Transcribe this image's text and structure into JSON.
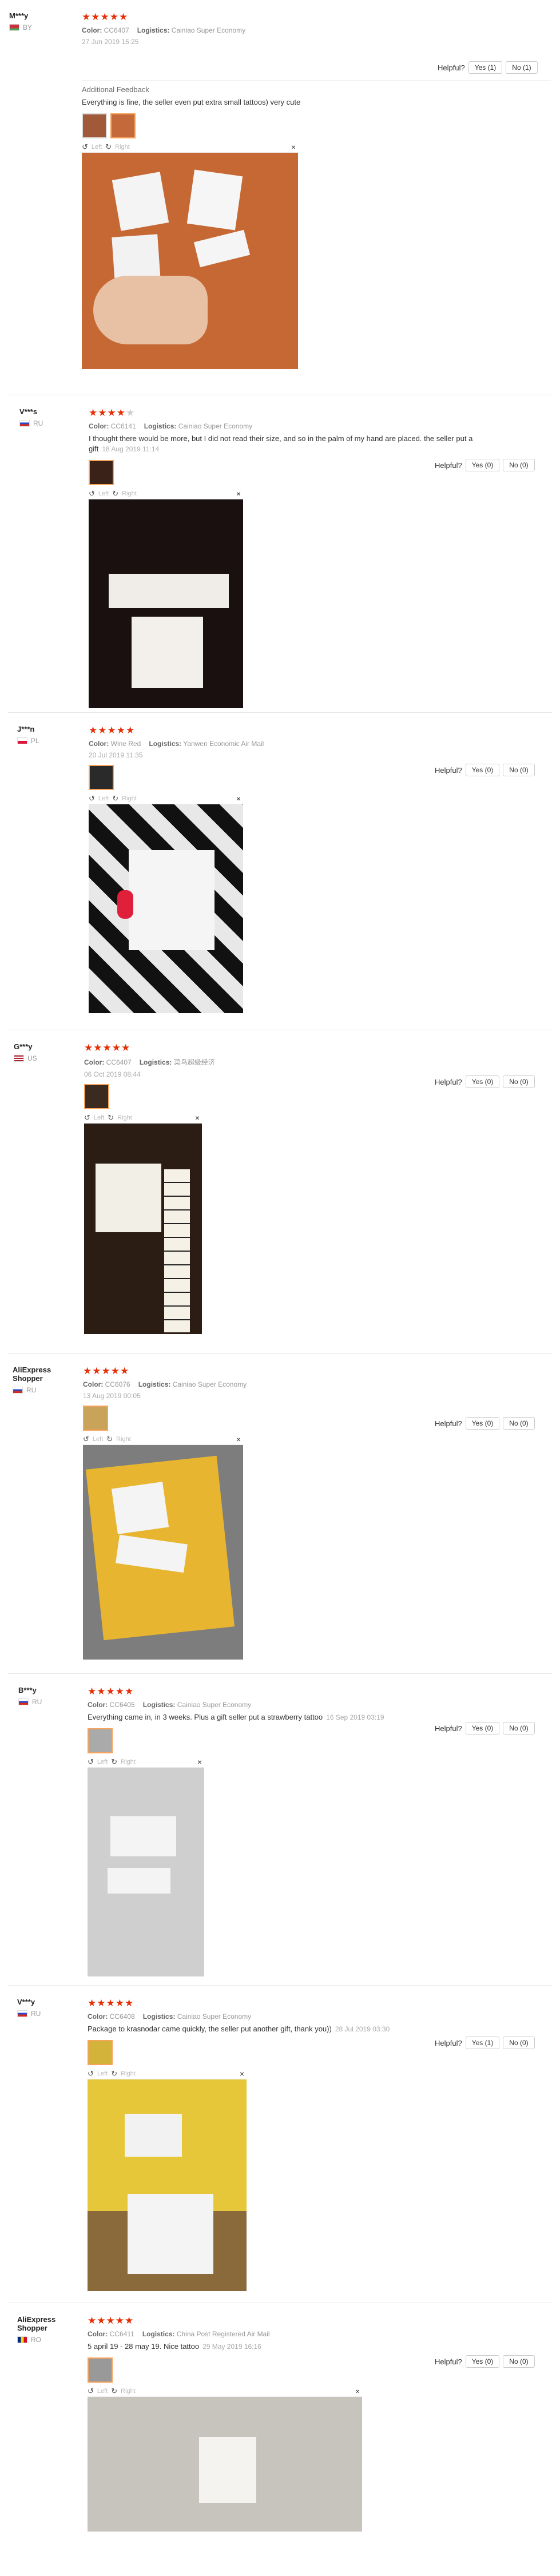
{
  "common": {
    "helpful": "Helpful?",
    "left": "Left",
    "right": "Right",
    "close": "×",
    "rotate_left_icon": "↺",
    "rotate_right_icon": "↻",
    "color_label": "Color:",
    "logistics_label": "Logistics:",
    "stars_full": "★★★★★",
    "star_icon": "★"
  },
  "reviews": [
    {
      "user": "M***y",
      "country": "BY",
      "stars": 5,
      "color": "CC6407",
      "logistics": "Cainiao Super Economy",
      "date": "27 Jun 2019 15:25",
      "text": "",
      "yes": "Yes (1)",
      "no": "No (1)",
      "feedback_title": "Additional Feedback",
      "feedback_text": "Everything is fine, the seller even put extra small tattoos) very cute"
    },
    {
      "user": "V***s",
      "country": "RU",
      "stars": 4,
      "color": "CC6141",
      "logistics": "Cainiao Super Economy",
      "text": "I thought there would be more, but I did not read their size, and so in the palm of my hand are placed. the seller put a gift",
      "date": "18 Aug 2019 11:14",
      "yes": "Yes (0)",
      "no": "No (0)"
    },
    {
      "user": "J***n",
      "country": "PL",
      "stars": 5,
      "color": "Wine Red",
      "logistics": "Yanwen Economic Air Mail",
      "date": "20 Jul 2019 11:35",
      "text": "",
      "yes": "Yes (0)",
      "no": "No (0)"
    },
    {
      "user": "G***y",
      "country": "US",
      "stars": 5,
      "color": "CC6407",
      "logistics": "菜鸟超级经济",
      "date": "06 Oct 2019 08:44",
      "text": "",
      "yes": "Yes (0)",
      "no": "No (0)"
    },
    {
      "user": "AliExpress Shopper",
      "country": "RU",
      "stars": 5,
      "color": "CC6076",
      "logistics": "Cainiao Super Economy",
      "date": "13 Aug 2019 00:05",
      "text": "",
      "yes": "Yes (0)",
      "no": "No (0)"
    },
    {
      "user": "B***y",
      "country": "RU",
      "stars": 5,
      "color": "CC6405",
      "logistics": "Cainiao Super Economy",
      "text": "Everything came in, in 3 weeks. Plus a gift seller put a strawberry tattoo",
      "date": "16 Sep 2019 03:19",
      "yes": "Yes (0)",
      "no": "No (0)"
    },
    {
      "user": "V***y",
      "country": "RU",
      "stars": 5,
      "color": "CC6408",
      "logistics": "Cainiao Super Economy",
      "text": "Package to krasnodar came quickly, the seller put another gift, thank you))",
      "date": "28 Jul 2019 03:30",
      "yes": "Yes (1)",
      "no": "No (0)"
    },
    {
      "user": "AliExpress Shopper",
      "country": "RO",
      "stars": 5,
      "color": "CC6411",
      "logistics": "China Post Registered Air Mail",
      "text": "5 april 19 - 28 may 19. Nice tattoo",
      "date": "29 May 2019 16:16",
      "yes": "Yes (0)",
      "no": "No (0)"
    }
  ]
}
